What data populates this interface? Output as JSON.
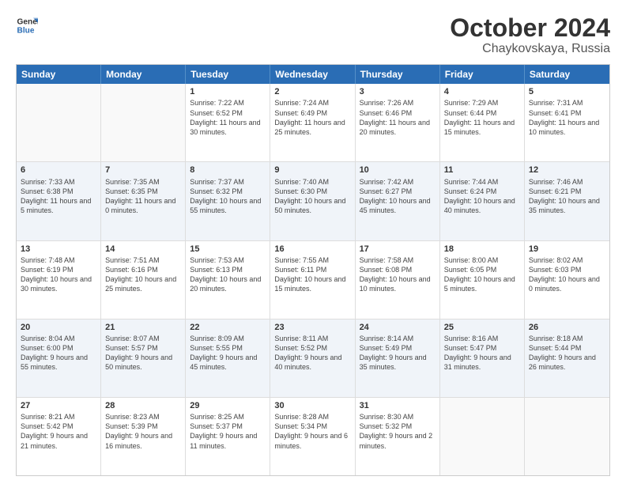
{
  "header": {
    "logo_line1": "General",
    "logo_line2": "Blue",
    "month": "October 2024",
    "location": "Chaykovskaya, Russia"
  },
  "days_of_week": [
    "Sunday",
    "Monday",
    "Tuesday",
    "Wednesday",
    "Thursday",
    "Friday",
    "Saturday"
  ],
  "weeks": [
    [
      {
        "day": "",
        "sunrise": "",
        "sunset": "",
        "daylight": "",
        "empty": true
      },
      {
        "day": "",
        "sunrise": "",
        "sunset": "",
        "daylight": "",
        "empty": true
      },
      {
        "day": "1",
        "sunrise": "Sunrise: 7:22 AM",
        "sunset": "Sunset: 6:52 PM",
        "daylight": "Daylight: 11 hours and 30 minutes."
      },
      {
        "day": "2",
        "sunrise": "Sunrise: 7:24 AM",
        "sunset": "Sunset: 6:49 PM",
        "daylight": "Daylight: 11 hours and 25 minutes."
      },
      {
        "day": "3",
        "sunrise": "Sunrise: 7:26 AM",
        "sunset": "Sunset: 6:46 PM",
        "daylight": "Daylight: 11 hours and 20 minutes."
      },
      {
        "day": "4",
        "sunrise": "Sunrise: 7:29 AM",
        "sunset": "Sunset: 6:44 PM",
        "daylight": "Daylight: 11 hours and 15 minutes."
      },
      {
        "day": "5",
        "sunrise": "Sunrise: 7:31 AM",
        "sunset": "Sunset: 6:41 PM",
        "daylight": "Daylight: 11 hours and 10 minutes."
      }
    ],
    [
      {
        "day": "6",
        "sunrise": "Sunrise: 7:33 AM",
        "sunset": "Sunset: 6:38 PM",
        "daylight": "Daylight: 11 hours and 5 minutes."
      },
      {
        "day": "7",
        "sunrise": "Sunrise: 7:35 AM",
        "sunset": "Sunset: 6:35 PM",
        "daylight": "Daylight: 11 hours and 0 minutes."
      },
      {
        "day": "8",
        "sunrise": "Sunrise: 7:37 AM",
        "sunset": "Sunset: 6:32 PM",
        "daylight": "Daylight: 10 hours and 55 minutes."
      },
      {
        "day": "9",
        "sunrise": "Sunrise: 7:40 AM",
        "sunset": "Sunset: 6:30 PM",
        "daylight": "Daylight: 10 hours and 50 minutes."
      },
      {
        "day": "10",
        "sunrise": "Sunrise: 7:42 AM",
        "sunset": "Sunset: 6:27 PM",
        "daylight": "Daylight: 10 hours and 45 minutes."
      },
      {
        "day": "11",
        "sunrise": "Sunrise: 7:44 AM",
        "sunset": "Sunset: 6:24 PM",
        "daylight": "Daylight: 10 hours and 40 minutes."
      },
      {
        "day": "12",
        "sunrise": "Sunrise: 7:46 AM",
        "sunset": "Sunset: 6:21 PM",
        "daylight": "Daylight: 10 hours and 35 minutes."
      }
    ],
    [
      {
        "day": "13",
        "sunrise": "Sunrise: 7:48 AM",
        "sunset": "Sunset: 6:19 PM",
        "daylight": "Daylight: 10 hours and 30 minutes."
      },
      {
        "day": "14",
        "sunrise": "Sunrise: 7:51 AM",
        "sunset": "Sunset: 6:16 PM",
        "daylight": "Daylight: 10 hours and 25 minutes."
      },
      {
        "day": "15",
        "sunrise": "Sunrise: 7:53 AM",
        "sunset": "Sunset: 6:13 PM",
        "daylight": "Daylight: 10 hours and 20 minutes."
      },
      {
        "day": "16",
        "sunrise": "Sunrise: 7:55 AM",
        "sunset": "Sunset: 6:11 PM",
        "daylight": "Daylight: 10 hours and 15 minutes."
      },
      {
        "day": "17",
        "sunrise": "Sunrise: 7:58 AM",
        "sunset": "Sunset: 6:08 PM",
        "daylight": "Daylight: 10 hours and 10 minutes."
      },
      {
        "day": "18",
        "sunrise": "Sunrise: 8:00 AM",
        "sunset": "Sunset: 6:05 PM",
        "daylight": "Daylight: 10 hours and 5 minutes."
      },
      {
        "day": "19",
        "sunrise": "Sunrise: 8:02 AM",
        "sunset": "Sunset: 6:03 PM",
        "daylight": "Daylight: 10 hours and 0 minutes."
      }
    ],
    [
      {
        "day": "20",
        "sunrise": "Sunrise: 8:04 AM",
        "sunset": "Sunset: 6:00 PM",
        "daylight": "Daylight: 9 hours and 55 minutes."
      },
      {
        "day": "21",
        "sunrise": "Sunrise: 8:07 AM",
        "sunset": "Sunset: 5:57 PM",
        "daylight": "Daylight: 9 hours and 50 minutes."
      },
      {
        "day": "22",
        "sunrise": "Sunrise: 8:09 AM",
        "sunset": "Sunset: 5:55 PM",
        "daylight": "Daylight: 9 hours and 45 minutes."
      },
      {
        "day": "23",
        "sunrise": "Sunrise: 8:11 AM",
        "sunset": "Sunset: 5:52 PM",
        "daylight": "Daylight: 9 hours and 40 minutes."
      },
      {
        "day": "24",
        "sunrise": "Sunrise: 8:14 AM",
        "sunset": "Sunset: 5:49 PM",
        "daylight": "Daylight: 9 hours and 35 minutes."
      },
      {
        "day": "25",
        "sunrise": "Sunrise: 8:16 AM",
        "sunset": "Sunset: 5:47 PM",
        "daylight": "Daylight: 9 hours and 31 minutes."
      },
      {
        "day": "26",
        "sunrise": "Sunrise: 8:18 AM",
        "sunset": "Sunset: 5:44 PM",
        "daylight": "Daylight: 9 hours and 26 minutes."
      }
    ],
    [
      {
        "day": "27",
        "sunrise": "Sunrise: 8:21 AM",
        "sunset": "Sunset: 5:42 PM",
        "daylight": "Daylight: 9 hours and 21 minutes."
      },
      {
        "day": "28",
        "sunrise": "Sunrise: 8:23 AM",
        "sunset": "Sunset: 5:39 PM",
        "daylight": "Daylight: 9 hours and 16 minutes."
      },
      {
        "day": "29",
        "sunrise": "Sunrise: 8:25 AM",
        "sunset": "Sunset: 5:37 PM",
        "daylight": "Daylight: 9 hours and 11 minutes."
      },
      {
        "day": "30",
        "sunrise": "Sunrise: 8:28 AM",
        "sunset": "Sunset: 5:34 PM",
        "daylight": "Daylight: 9 hours and 6 minutes."
      },
      {
        "day": "31",
        "sunrise": "Sunrise: 8:30 AM",
        "sunset": "Sunset: 5:32 PM",
        "daylight": "Daylight: 9 hours and 2 minutes."
      },
      {
        "day": "",
        "sunrise": "",
        "sunset": "",
        "daylight": "",
        "empty": true
      },
      {
        "day": "",
        "sunrise": "",
        "sunset": "",
        "daylight": "",
        "empty": true
      }
    ]
  ]
}
